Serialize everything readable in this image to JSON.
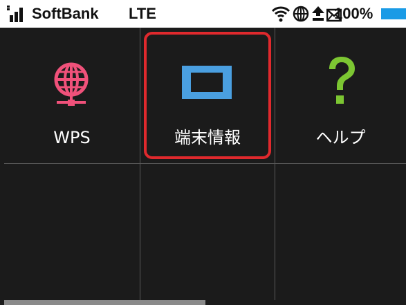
{
  "status_bar": {
    "carrier": "SoftBank",
    "network": "LTE",
    "battery_percent_text": "100%",
    "battery_level": 1.0,
    "icons": [
      "signal-bars-icon",
      "wifi-icon",
      "globe-icon",
      "upload-arrow-icon",
      "mail-icon",
      "battery-icon"
    ],
    "battery_color": "#1a9be6"
  },
  "tiles": [
    {
      "label": "WPS",
      "icon": "globe-network-icon",
      "icon_color": "#f0517a",
      "selected": false
    },
    {
      "label": "端末情報",
      "icon": "device-screen-icon",
      "icon_color": "#4a9fe0",
      "selected": true
    },
    {
      "label": "ヘルプ",
      "icon": "question-mark-icon",
      "icon_color": "#7cc632",
      "selected": false
    },
    {
      "label": "",
      "icon": "",
      "selected": false
    },
    {
      "label": "",
      "icon": "",
      "selected": false
    },
    {
      "label": "",
      "icon": "",
      "selected": false
    }
  ],
  "colors": {
    "background": "#1b1b1b",
    "grid_line": "#5a5a5a",
    "selection_border": "#e0292d"
  },
  "scroll": {
    "thumb_fraction": 0.5
  }
}
